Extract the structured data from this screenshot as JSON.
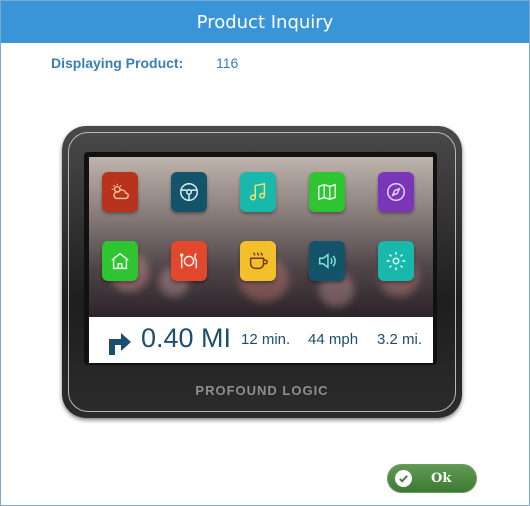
{
  "dialog": {
    "title": "Product Inquiry",
    "product_label": "Displaying Product:",
    "product_value": "116"
  },
  "device": {
    "brand": "PROFOUND LOGIC",
    "apps": [
      {
        "icon": "weather-icon",
        "color": "#b8331e"
      },
      {
        "icon": "steering-wheel-icon",
        "color": "#14546a"
      },
      {
        "icon": "music-icon",
        "color": "#19b8ad"
      },
      {
        "icon": "map-icon",
        "color": "#2ec432"
      },
      {
        "icon": "compass-icon",
        "color": "#7b35b8"
      },
      {
        "icon": "home-icon",
        "color": "#2ec432"
      },
      {
        "icon": "dining-icon",
        "color": "#e2482c"
      },
      {
        "icon": "coffee-icon",
        "color": "#f3c02c"
      },
      {
        "icon": "volume-icon",
        "color": "#14546a"
      },
      {
        "icon": "settings-icon",
        "color": "#19b8ad"
      }
    ],
    "nav": {
      "distance": "0.40 MI",
      "time": "12 min.",
      "speed": "44 mph",
      "miles": "3.2 mi."
    }
  },
  "buttons": {
    "ok_label": "Ok",
    "ok_color": "#4a8a40"
  }
}
